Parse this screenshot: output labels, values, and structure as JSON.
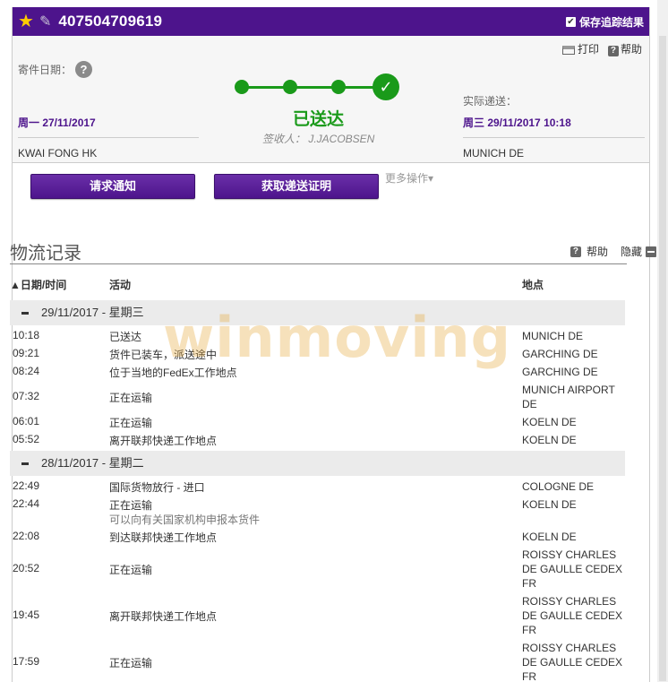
{
  "header": {
    "tracking_number": "407504709619",
    "save_label": "保存追踪结果"
  },
  "summary": {
    "print_label": "打印",
    "help_label": "帮助",
    "ship_date_label": "寄件日期：",
    "ship_date": "周一 27/11/2017",
    "origin": "KWAI FONG HK",
    "delivery_label": "实际递送：",
    "delivery_date": "周三 29/11/2017 10:18",
    "destination": "MUNICH DE",
    "status": "已送达",
    "signed_by": "签收人： J.JACOBSEN"
  },
  "actions": {
    "notify_label": "请求通知",
    "proof_label": "获取递送证明",
    "more_label": "更多操作▾"
  },
  "history": {
    "title": "物流记录",
    "help_label": "帮助",
    "hide_label": "隐藏",
    "col_date": "▲日期/时间",
    "col_activity": "活动",
    "col_location": "地点",
    "day1": "29/11/2017 - 星期三",
    "day1_rows": [
      {
        "time": "10:18",
        "activity": "已送达",
        "location": "MUNICH DE"
      },
      {
        "time": "09:21",
        "activity": "货件已装车，派送途中",
        "location": "GARCHING DE"
      },
      {
        "time": "08:24",
        "activity": "位于当地的FedEx工作地点",
        "location": "GARCHING DE"
      },
      {
        "time": "07:32",
        "activity": "正在运输",
        "location": "MUNICH AIRPORT DE"
      },
      {
        "time": "06:01",
        "activity": "正在运输",
        "location": "KOELN DE"
      },
      {
        "time": "05:52",
        "activity": "离开联邦快递工作地点",
        "location": "KOELN DE"
      }
    ],
    "day2": "28/11/2017 - 星期二",
    "day2_rows": [
      {
        "time": "22:49",
        "activity": "国际货物放行 - 进口",
        "location": "COLOGNE DE"
      },
      {
        "time": "22:44",
        "activity": "正在运输",
        "note": "可以向有关国家机构申报本货件",
        "location": "KOELN DE"
      },
      {
        "time": "22:08",
        "activity": "到达联邦快递工作地点",
        "location": "KOELN DE"
      },
      {
        "time": "20:52",
        "activity": "正在运输",
        "location": "ROISSY CHARLES DE GAULLE CEDEX FR"
      },
      {
        "time": "19:45",
        "activity": "离开联邦快递工作地点",
        "location": "ROISSY CHARLES DE GAULLE CEDEX FR"
      },
      {
        "time": "17:59",
        "activity": "正在运输",
        "location": "ROISSY CHARLES DE GAULLE CEDEX FR"
      }
    ]
  },
  "watermark": "winmoving",
  "colors": {
    "brand_purple": "#4d148c",
    "delivered_green": "#1a9a1a"
  }
}
